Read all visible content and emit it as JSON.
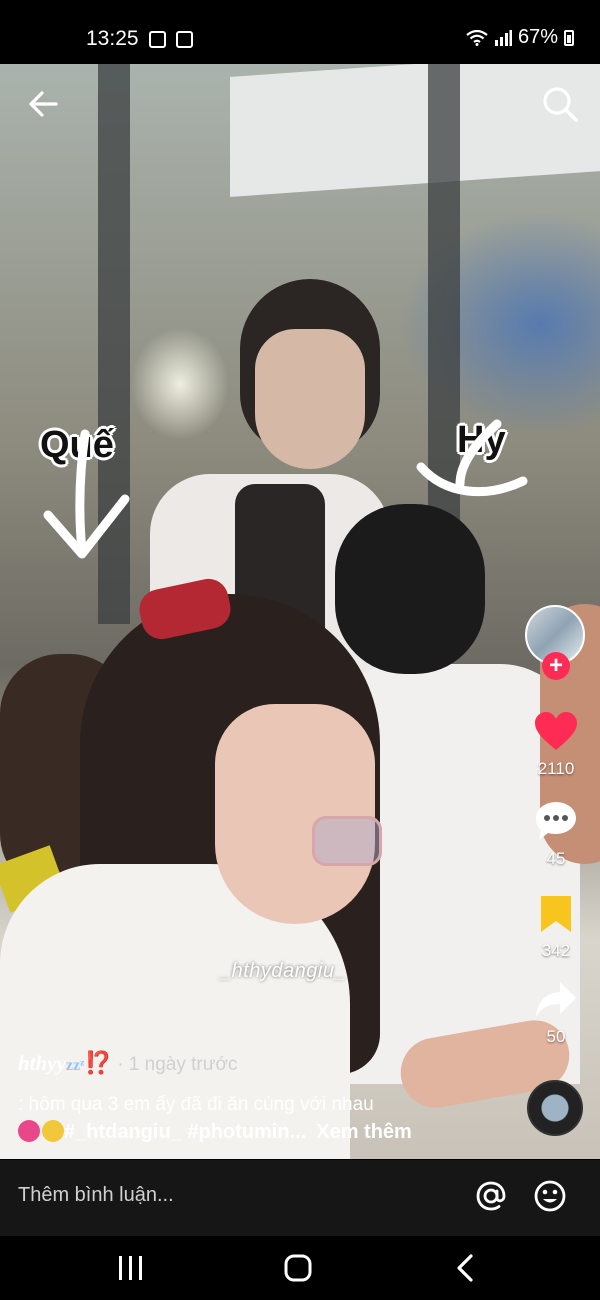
{
  "status_bar": {
    "time": "13:25",
    "battery": "67%"
  },
  "video": {
    "name_left": "Quế",
    "name_right": "Hy",
    "watermark": "_hthydangiu_"
  },
  "rail": {
    "likes": "2110",
    "comments": "45",
    "saves": "342",
    "shares": "50",
    "like_color": "#fe2c55",
    "save_color": "#f7c51e"
  },
  "post": {
    "author": "hthyy",
    "author_emoji_sleep": "zzᶻ",
    "author_emoji_mark": "⁉️",
    "posted": "· 1 ngày trước",
    "caption": ": hôm qua 3 em ấy đã đi ăn cùng với nhau",
    "hashtags": "#_htdangiu_ #photumin...",
    "see_more": "Xem thêm"
  },
  "comment_bar": {
    "placeholder": "Thêm bình luận..."
  },
  "icons": {
    "back": "arrow-left-icon",
    "search": "search-icon",
    "like": "heart-icon",
    "comment": "comment-bubble-icon",
    "save": "bookmark-icon",
    "share": "share-arrow-icon",
    "mention": "at-sign-icon",
    "emoji": "smiley-icon"
  }
}
